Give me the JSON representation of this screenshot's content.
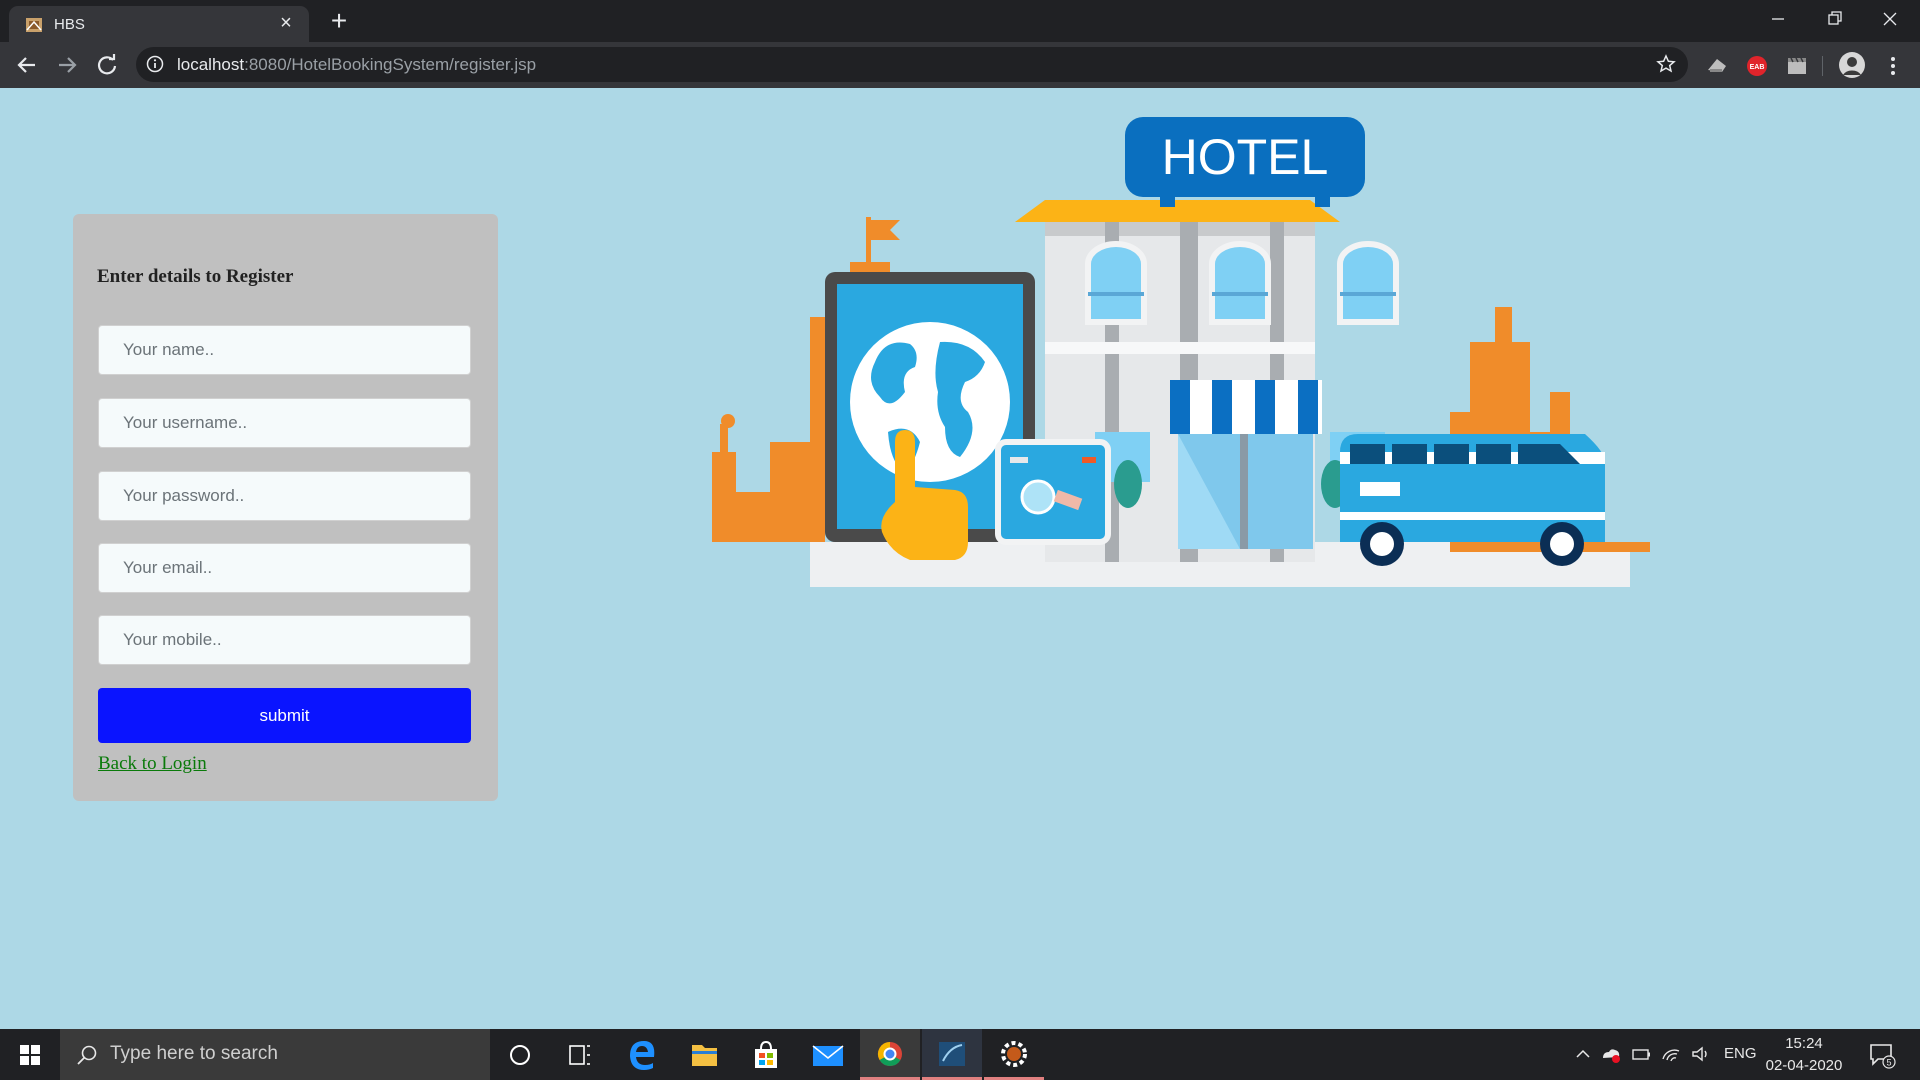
{
  "browser": {
    "tab_title": "HBS",
    "url_host": "localhost",
    "url_rest": ":8080/HotelBookingSystem/register.jsp"
  },
  "form": {
    "heading": "Enter details to Register",
    "name_placeholder": "Your name..",
    "username_placeholder": "Your username..",
    "password_placeholder": "Your password..",
    "email_placeholder": "Your email..",
    "mobile_placeholder": "Your mobile..",
    "submit_label": "submit",
    "back_link": "Back to Login"
  },
  "hero": {
    "sign_text": "HOTEL"
  },
  "taskbar": {
    "search_placeholder": "Type here to search",
    "language": "ENG",
    "time": "15:24",
    "date": "02-04-2020",
    "notification_count": "5"
  },
  "colors": {
    "page_background": "#add8e6",
    "form_panel": "#c0c0c0",
    "submit_button": "#0a14ff",
    "link": "#0a7a0a"
  },
  "icons": [
    "favicon-icon",
    "close-icon",
    "plus-icon",
    "minimize-icon",
    "restore-icon",
    "back-arrow-icon",
    "forward-arrow-icon",
    "reload-icon",
    "info-icon",
    "star-icon",
    "extension-icon",
    "avatar-icon",
    "more-icon",
    "windows-icon",
    "search-icon",
    "cortana-icon",
    "task-view-icon",
    "edge-icon",
    "folder-icon",
    "store-icon",
    "mail-icon",
    "chrome-icon",
    "app-icon",
    "settings-app-icon",
    "chevron-up-icon",
    "network-icon",
    "battery-icon",
    "wifi-icon",
    "volume-icon",
    "notification-icon"
  ]
}
